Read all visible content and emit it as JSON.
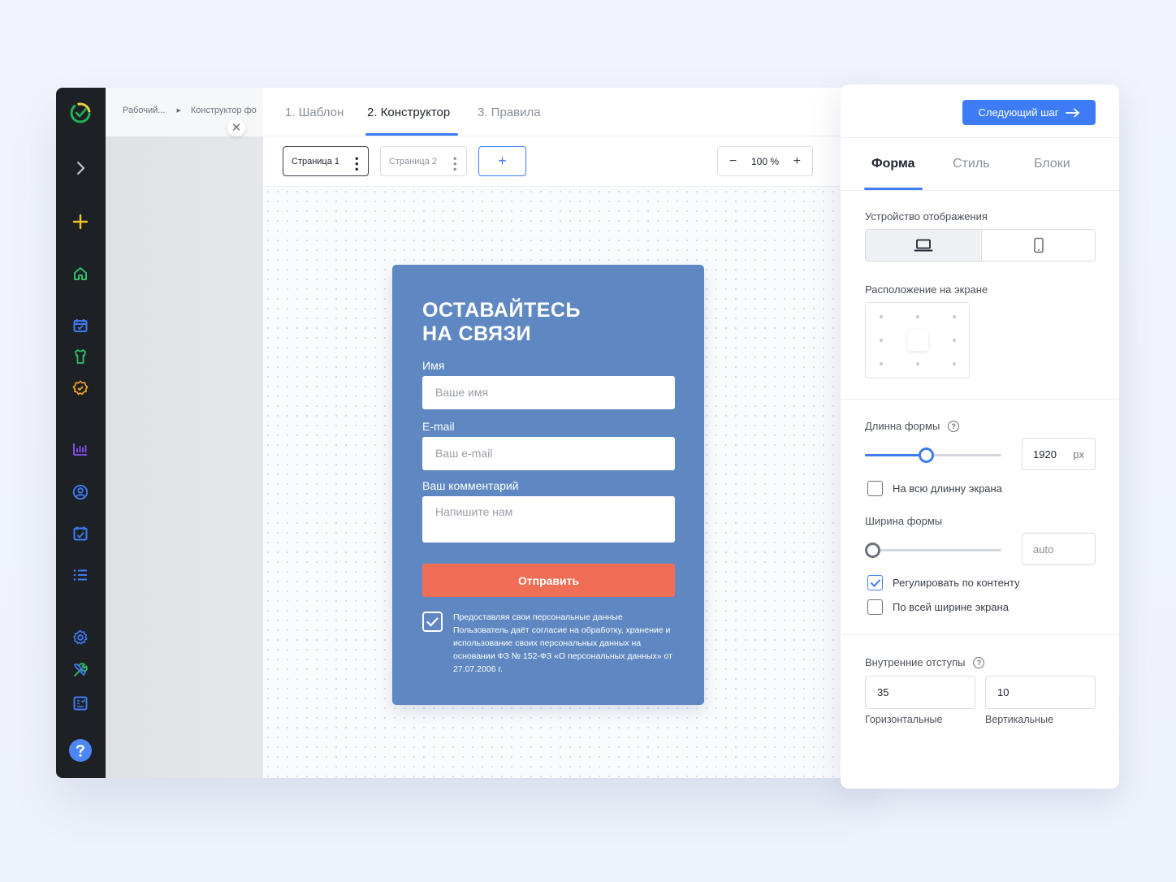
{
  "breadcrumbs": [
    "Рабочий...",
    "Конструктор фо"
  ],
  "steps": [
    {
      "label": "1. Шаблон",
      "active": false
    },
    {
      "label": "2. Конструктор",
      "active": true
    },
    {
      "label": "3. Правила",
      "active": false
    }
  ],
  "pages": [
    {
      "label": "Страница 1",
      "active": true
    },
    {
      "label": "Страница 2",
      "active": false
    }
  ],
  "add_page_label": "+",
  "zoom": {
    "minus": "−",
    "value": "100 %",
    "plus": "+"
  },
  "form_preview": {
    "title_line1": "ОСТАВАЙТЕСЬ",
    "title_line2": "НА СВЯЗИ",
    "name_label": "Имя",
    "name_placeholder": "Ваше имя",
    "email_label": "E-mail",
    "email_placeholder": "Ваш e-mail",
    "comment_label": "Ваш комментарий",
    "comment_placeholder": "Напишите нам",
    "submit_label": "Отправить",
    "consent_checked": true,
    "consent_text": "Предоставляя свои персональные данные Пользователь даёт согласие на обработку, хранение и использование своих персональных данных на основании ФЗ № 152-ФЗ «О персональных данных» от 27.07.2006 г."
  },
  "panel": {
    "next_button": "Следующий шаг",
    "tabs": [
      {
        "label": "Форма",
        "active": true
      },
      {
        "label": "Стиль",
        "active": false
      },
      {
        "label": "Блоки",
        "active": false
      }
    ],
    "device_label": "Устройство отображения",
    "device_selected": "desktop",
    "position_label": "Расположение на экране",
    "length_label": "Длинна формы",
    "length_value": "1920",
    "length_unit": "px",
    "length_slider_fraction": 0.44,
    "full_length_label": "На всю длинну экрана",
    "full_length_checked": false,
    "width_label": "Ширина формы",
    "width_value": "auto",
    "width_slider_fraction": 0,
    "fit_content_label": "Регулировать по контенту",
    "fit_content_checked": true,
    "full_width_label": "По всей ширине экрана",
    "full_width_checked": false,
    "padding_label": "Внутренние отступы",
    "padding_horizontal": "35",
    "padding_vertical": "10",
    "padding_horizontal_caption": "Горизонтальные",
    "padding_vertical_caption": "Вертикальные",
    "help_glyph": "?"
  },
  "colors": {
    "accent": "#3d7cf5",
    "form_background": "#5f88c2",
    "submit_button": "#ef6e55",
    "rail_background": "#1d2024"
  },
  "rail_icons": [
    "logo-icon",
    "chevron-right-icon",
    "plus-icon",
    "home-icon",
    "calendar-check-icon",
    "shirt-icon",
    "badge-check-icon",
    "bar-chart-icon",
    "user-circle-icon",
    "task-icon",
    "list-icon",
    "settings-icon",
    "tools-icon",
    "report-icon",
    "help-icon"
  ]
}
